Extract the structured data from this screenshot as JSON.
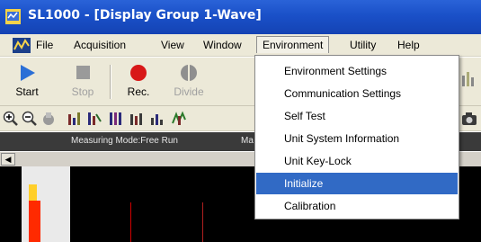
{
  "window": {
    "title": "SL1000 - [Display Group 1-Wave]"
  },
  "menubar": {
    "items": [
      "File",
      "Acquisition",
      "View",
      "Window",
      "Environment",
      "Utility",
      "Help"
    ],
    "active": "Environment"
  },
  "toolbar": {
    "buttons": [
      {
        "label": "Start",
        "icon": "play-icon",
        "enabled": true
      },
      {
        "label": "Stop",
        "icon": "stop-icon",
        "enabled": false
      },
      {
        "label": "Rec.",
        "icon": "record-icon",
        "enabled": true
      },
      {
        "label": "Divide",
        "icon": "divide-icon",
        "enabled": false
      }
    ]
  },
  "status": {
    "measuring_mode": "Measuring Mode:Free Run",
    "partial": "Ma"
  },
  "environment_menu": {
    "items": [
      "Environment Settings",
      "Communication Settings",
      "Self Test",
      "Unit System Information",
      "Unit Key-Lock",
      "Initialize",
      "Calibration"
    ],
    "selected": "Initialize"
  },
  "colors": {
    "titlebar": "#1a50c8",
    "selection": "#316ac5",
    "record_red": "#d81818",
    "play_blue": "#2b6fd6"
  }
}
